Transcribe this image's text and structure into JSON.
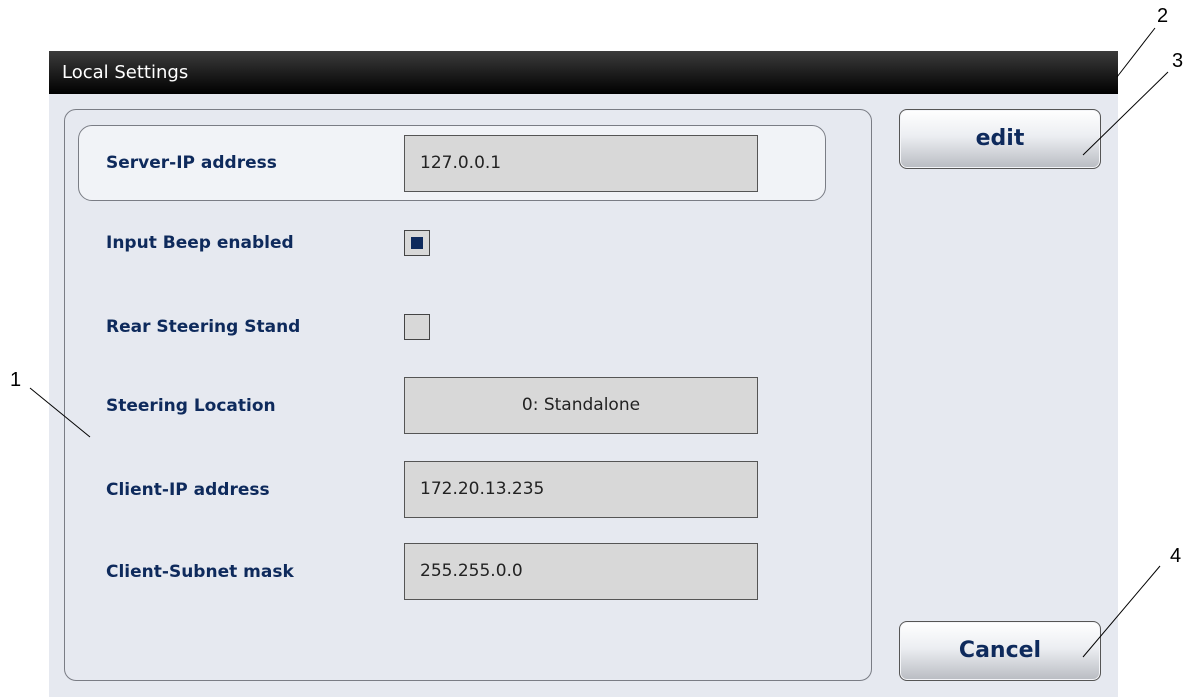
{
  "window": {
    "title": "Local Settings"
  },
  "settings": {
    "server_ip": {
      "label": "Server-IP address",
      "value": "127.0.0.1"
    },
    "input_beep": {
      "label": "Input Beep enabled",
      "checked": true
    },
    "rear_steering": {
      "label": "Rear Steering Stand",
      "checked": false
    },
    "steering_location": {
      "label": "Steering Location",
      "value": "0: Standalone"
    },
    "client_ip": {
      "label": "Client-IP address",
      "value": "172.20.13.235"
    },
    "client_subnet": {
      "label": "Client-Subnet mask",
      "value": "255.255.0.0"
    }
  },
  "buttons": {
    "edit_label": "edit",
    "cancel_label": "Cancel"
  },
  "callouts": {
    "c1": "1",
    "c2": "2",
    "c3": "3",
    "c4": "4"
  },
  "colors": {
    "label_text": "#0e2a5c",
    "background": "#e6e9f0",
    "field_bg": "#d8d8d8"
  }
}
